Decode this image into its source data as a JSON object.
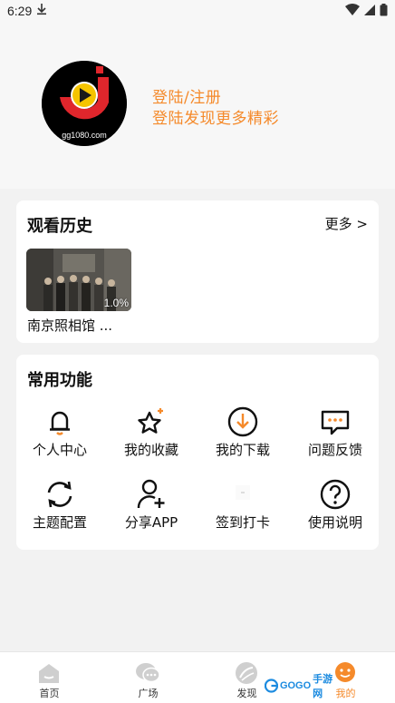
{
  "status_bar": {
    "time": "6:29"
  },
  "profile": {
    "avatar_text": "gg1080.com",
    "login_title": "登陆/注册",
    "login_subtitle": "登陆发现更多精彩"
  },
  "history": {
    "title": "观看历史",
    "more": "更多 >",
    "items": [
      {
        "title": "南京照相馆 ...",
        "progress": "1.0%"
      }
    ]
  },
  "functions": {
    "title": "常用功能",
    "items": [
      {
        "label": "个人中心",
        "icon": "bell-icon"
      },
      {
        "label": "我的收藏",
        "icon": "star-sparkle-icon"
      },
      {
        "label": "我的下载",
        "icon": "download-icon"
      },
      {
        "label": "问题反馈",
        "icon": "chat-bubble-icon"
      },
      {
        "label": "主题配置",
        "icon": "refresh-icon"
      },
      {
        "label": "分享APP",
        "icon": "user-add-icon"
      },
      {
        "label": "签到打卡",
        "icon": "checkin-icon"
      },
      {
        "label": "使用说明",
        "icon": "help-circle-icon"
      }
    ]
  },
  "bottom_nav": {
    "items": [
      {
        "label": "首页",
        "icon": "home-icon"
      },
      {
        "label": "广场",
        "icon": "square-chat-icon"
      },
      {
        "label": "发现",
        "icon": "discover-icon"
      },
      {
        "label": "我的",
        "icon": "mine-icon",
        "active": true
      }
    ]
  },
  "watermark": {
    "brand": "GOGO",
    "cn": "手游网"
  },
  "colors": {
    "accent": "#f58a2b",
    "background": "#f2f2f2",
    "card": "#ffffff"
  }
}
